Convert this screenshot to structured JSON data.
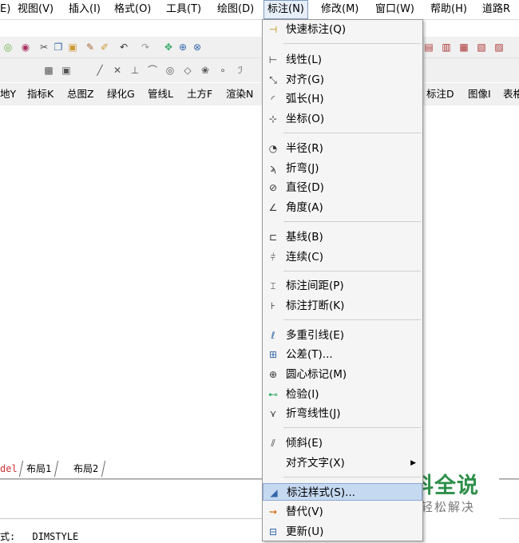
{
  "menubar": {
    "items": [
      "E)",
      "视图(V)",
      "插入(I)",
      "格式(O)",
      "工具(T)",
      "绘图(D)",
      "标注(N)",
      "修改(M)",
      "窗口(W)",
      "帮助(H)",
      "道路R"
    ],
    "active_index": 6
  },
  "toolbar3": {
    "left_items": [
      "地Y",
      "指标K",
      "总图Z",
      "绿化G",
      "管线L",
      "土方F",
      "渲染N"
    ],
    "right_items": [
      "标注D",
      "图像I",
      "表格"
    ]
  },
  "layout_tabs": [
    "del",
    "布局1",
    "布局2"
  ],
  "command": {
    "prompt": "式:",
    "text": "DIMSTYLE"
  },
  "dim_menu": {
    "items": [
      {
        "label": "快速标注(Q)",
        "icon": "quick-dim-icon"
      },
      {
        "label": "线性(L)",
        "icon": "linear-dim-icon"
      },
      {
        "label": "对齐(G)",
        "icon": "aligned-dim-icon"
      },
      {
        "label": "弧长(H)",
        "icon": "arc-length-icon"
      },
      {
        "label": "坐标(O)",
        "icon": "ordinate-icon"
      },
      {
        "label": "半径(R)",
        "icon": "radius-icon"
      },
      {
        "label": "折弯(J)",
        "icon": "jogged-icon"
      },
      {
        "label": "直径(D)",
        "icon": "diameter-icon"
      },
      {
        "label": "角度(A)",
        "icon": "angular-icon"
      },
      {
        "label": "基线(B)",
        "icon": "baseline-icon"
      },
      {
        "label": "连续(C)",
        "icon": "continue-icon"
      },
      {
        "label": "标注间距(P)",
        "icon": "dim-space-icon"
      },
      {
        "label": "标注打断(K)",
        "icon": "dim-break-icon"
      },
      {
        "label": "多重引线(E)",
        "icon": "multileader-icon"
      },
      {
        "label": "公差(T)...",
        "icon": "tolerance-icon"
      },
      {
        "label": "圆心标记(M)",
        "icon": "center-mark-icon"
      },
      {
        "label": "检验(I)",
        "icon": "inspect-icon"
      },
      {
        "label": "折弯线性(J)",
        "icon": "jogged-linear-icon"
      },
      {
        "label": "倾斜(E)",
        "icon": "oblique-icon"
      },
      {
        "label": "对齐文字(X)",
        "icon": ""
      },
      {
        "label": "标注样式(S)...",
        "icon": "dim-style-icon"
      },
      {
        "label": "替代(V)",
        "icon": "override-icon"
      },
      {
        "label": "更新(U)",
        "icon": "update-icon"
      }
    ],
    "highlighted_index": 20
  },
  "watermark": {
    "title": "百科全说",
    "subtitle": "助你轻松解决"
  },
  "colors": {
    "menu_bg": "#f5f5f5",
    "highlight": "#c5d9f1",
    "watermark_green": "#2e8f4a"
  }
}
